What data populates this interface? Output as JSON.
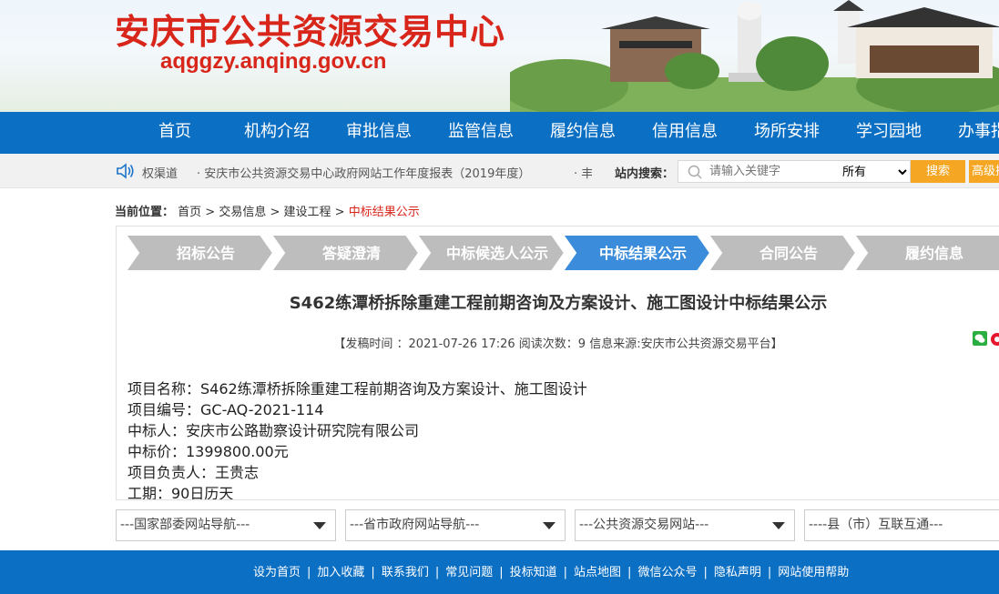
{
  "header": {
    "title": "安庆市公共资源交易中心",
    "domain": "aqggzy.anqing.gov.cn"
  },
  "nav": {
    "items": [
      "首页",
      "机构介绍",
      "审批信息",
      "监管信息",
      "履约信息",
      "信用信息",
      "场所安排",
      "学习园地",
      "办事指南"
    ]
  },
  "notice": {
    "channel": "权渠道",
    "headline": "· 安庆市公共资源交易中心政府网站工作年度报表（2019年度）",
    "dot": "· 丰",
    "search_label": "站内搜索：",
    "search_placeholder": "请输入关键字",
    "scope_selected": "所有",
    "search_button": "搜索",
    "advanced_button": "高级搜"
  },
  "breadcrumb": {
    "label": "当前位置：",
    "items": [
      "首页",
      "交易信息",
      "建设工程"
    ],
    "separator": " > ",
    "current": "中标结果公示"
  },
  "steps": [
    "招标公告",
    "答疑澄清",
    "中标候选人公示",
    "中标结果公示",
    "合同公告",
    "履约信息"
  ],
  "active_step_color": "#3b8ddb",
  "inactive_step_color": "#bdbdbd",
  "article": {
    "title": "S462练潭桥拆除重建工程前期咨询及方案设计、施工图设计中标结果公示",
    "meta": "【发稿时间 ：2021-07-26 17:26    阅读次数：9   信息来源:安庆市公共资源交易平台】",
    "lines": [
      "项目名称：S462练潭桥拆除重建工程前期咨询及方案设计、施工图设计",
      "项目编号：GC-AQ-2021-114",
      "中标人：安庆市公路勘察设计研究院有限公司",
      "中标价：1399800.00元",
      "项目负责人：王贵志",
      "工期：90日历天"
    ]
  },
  "dropdowns": [
    "---国家部委网站导航---",
    "---省市政府网站导航---",
    "---公共资源交易网站---",
    "----县（市）互联互通---"
  ],
  "footer": {
    "links": [
      "设为首页",
      "加入收藏",
      "联系我们",
      "常见问题",
      "投标知道",
      "站点地图",
      "微信公众号",
      "隐私声明",
      "网站使用帮助"
    ],
    "separator": "|"
  },
  "colors": {
    "brand_blue": "#0b6fc4",
    "title_red": "#d8261b",
    "button_orange": "#f5a623"
  }
}
